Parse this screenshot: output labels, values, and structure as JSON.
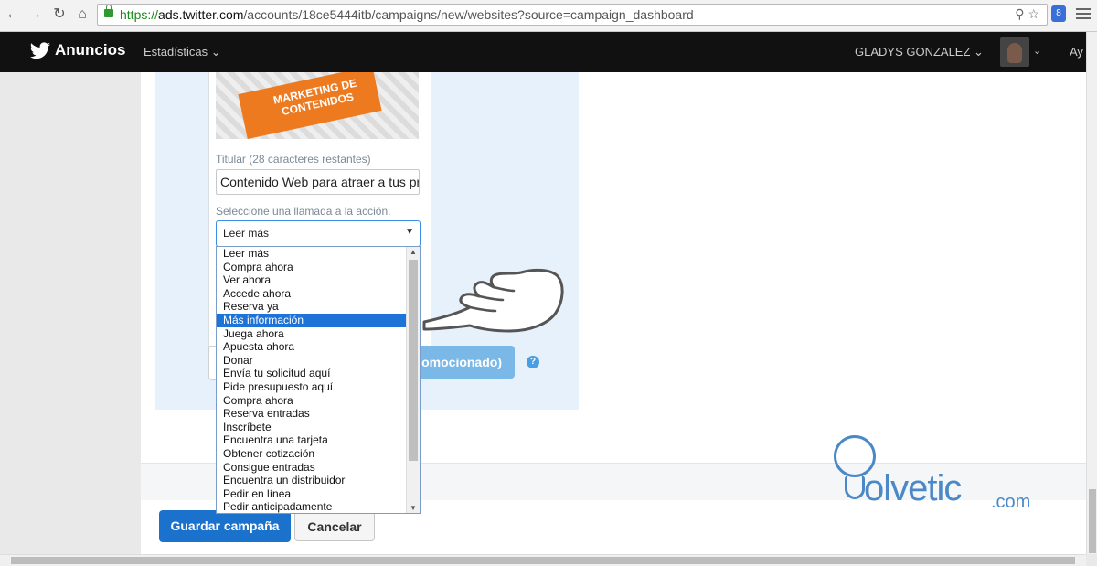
{
  "browser": {
    "url_secure": "https://",
    "url_host": "ads.twitter.com",
    "url_path": "/accounts/18ce5444itb/campaigns/new/websites?source=campaign_dashboard",
    "extension_badge": "8"
  },
  "topbar": {
    "brand": "Anuncios",
    "stats_menu": "Estadísticas",
    "user_name": "GLADYS GONZALEZ",
    "help_partial": "Ay"
  },
  "card": {
    "image_text_line1": "MARKETING DE",
    "image_text_line2": "CONTENIDOS",
    "headline_label": "Titular (28 caracteres restantes)",
    "headline_value": "Contenido Web para atraer a tus pr",
    "cta_label": "Seleccione una llamada a la acción.",
    "cta_selected": "Leer más"
  },
  "cta_options": [
    "Leer más",
    "Compra ahora",
    "Ver ahora",
    "Accede ahora",
    "Reserva ya",
    "Más información",
    "Juega ahora",
    "Apuesta ahora",
    "Donar",
    "Envía tu solicitud aquí",
    "Pide presupuesto aquí",
    "Compra ahora",
    "Reserva entradas",
    "Inscríbete",
    "Encuentra una tarjeta",
    "Obtener cotización",
    "Consigue entradas",
    "Encuentra un distribuidor",
    "Pedir en línea",
    "Pedir anticipadamente"
  ],
  "highlighted_option_index": 5,
  "promo_button_partial": "romocionado)",
  "help_icon": "?",
  "footer": {
    "save_label": "Guardar campaña",
    "cancel_label": "Cancelar"
  },
  "watermark": {
    "brand": "olvetic",
    "tld": ".com"
  },
  "colors": {
    "twitter_bar": "#111111",
    "primary_button": "#1b72cc",
    "selection": "#1e73d9",
    "panel_bg": "#e6f1fb"
  }
}
